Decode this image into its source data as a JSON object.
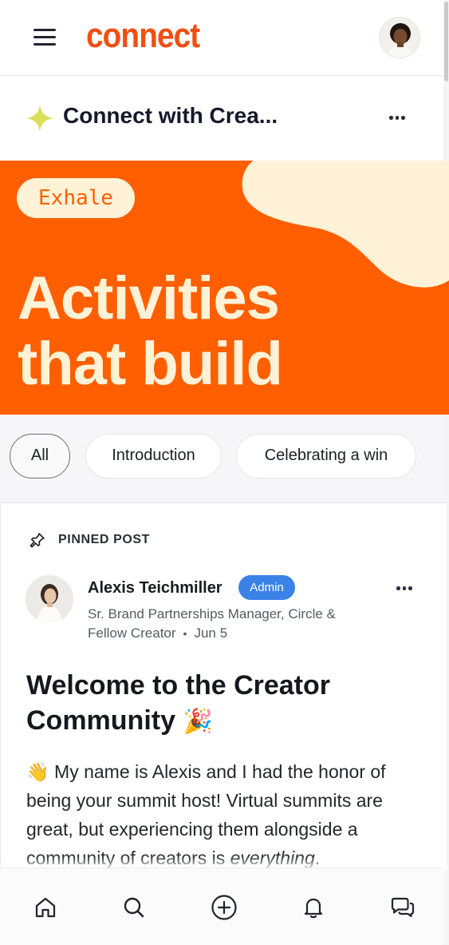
{
  "app": {
    "logo_text": "connect",
    "brand_color": "#f24e12"
  },
  "space": {
    "title": "Connect with Crea..."
  },
  "banner": {
    "tag": "Exhale",
    "headline_line1": "Activities",
    "headline_line2": "that build",
    "background_color": "#ff5f00",
    "accent_color": "#fff2d6"
  },
  "filters": {
    "chips": [
      {
        "label": "All",
        "active": true
      },
      {
        "label": "Introduction",
        "active": false
      },
      {
        "label": "Celebrating a win",
        "active": false
      }
    ]
  },
  "post": {
    "pinned_label": "PINNED POST",
    "author": {
      "name": "Alexis Teichmiller",
      "badge": "Admin",
      "role_line1": "Sr. Brand Partnerships Manager, Circle &",
      "role_line2": "Fellow Creator",
      "date": "Jun 5"
    },
    "title_line1": "Welcome to the Creator",
    "title_line2": "Community",
    "title_emoji": "🎉",
    "body_emoji": "👋",
    "body_text": "My name is Alexis and I had the honor of being your summit host! Virtual summits are great, but experiencing them alongside a community of creators is ",
    "body_emphasis": "everything",
    "body_end": "."
  },
  "bottom_nav": {
    "items": [
      {
        "icon": "home-icon"
      },
      {
        "icon": "search-icon"
      },
      {
        "icon": "plus-circle-icon"
      },
      {
        "icon": "bell-icon"
      },
      {
        "icon": "chat-icon"
      }
    ]
  }
}
